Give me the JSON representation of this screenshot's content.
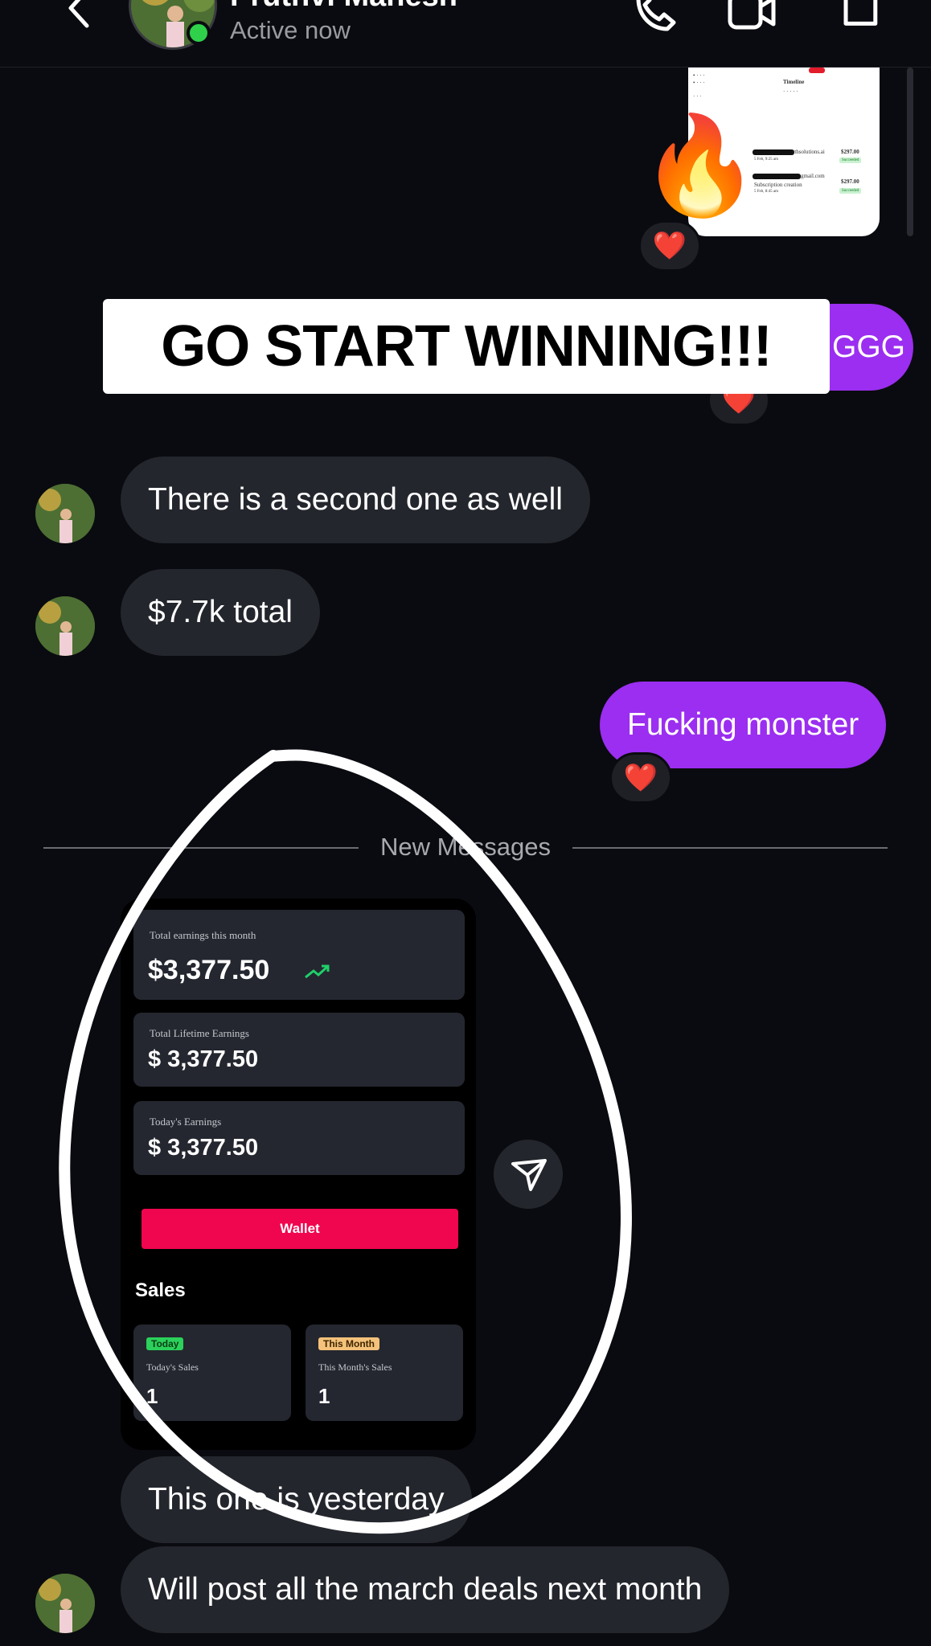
{
  "header": {
    "contact_name": "Pruthvi Mahesh",
    "status": "Active now",
    "icons": [
      "chevron-left-icon",
      "phone-icon",
      "video-icon",
      "tag-icon"
    ]
  },
  "top_image": {
    "payments": [
      {
        "email_suffix": "rthsolutions.ai",
        "amount": "$297.00",
        "date": "5 Feb, 9:25 am",
        "status": "Succeeded"
      },
      {
        "email_suffix": "gmail.com",
        "desc": "Subscription creation",
        "amount": "$297.00",
        "date": "5 Feb, 8:45 am",
        "status": "Succeeded"
      }
    ],
    "timeline_label": "Timeline"
  },
  "reactions": {
    "heart": "❤️",
    "fire": "🔥"
  },
  "caption": "GO START WINNING!!!",
  "messages": {
    "sent_partial": "GGG",
    "received_1": "There is a second one as well",
    "received_2": "$7.7k total",
    "sent_2": "Fucking monster",
    "divider": "New Messages",
    "received_3": "This one is yesterday",
    "received_4": "Will post all the march deals next month"
  },
  "earnings_card": {
    "month_label": "Total earnings this month",
    "month_value": "$3,377.50",
    "lifetime_label": "Total Lifetime Earnings",
    "lifetime_value": "$ 3,377.50",
    "today_label": "Today's Earnings",
    "today_value": "$ 3,377.50",
    "wallet_button": "Wallet",
    "sales_heading": "Sales",
    "today_badge": "Today",
    "today_sales_label": "Today's Sales",
    "today_sales_value": "1",
    "month_badge": "This Month",
    "month_sales_label": "This Month's Sales",
    "month_sales_value": "1"
  },
  "colors": {
    "background": "#0a0b10",
    "sent_bubble": "#9b2ef0",
    "received_bubble": "#24262d",
    "wallet_button": "#f0054f",
    "online": "#2fd14a"
  }
}
